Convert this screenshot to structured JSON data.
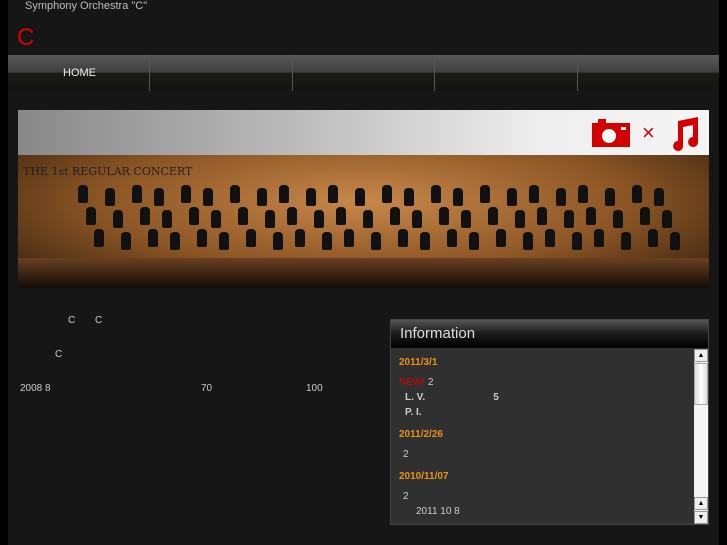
{
  "header": {
    "site_title": "Symphony Orchestra \"C\"",
    "logo": "C"
  },
  "nav": {
    "items": [
      "HOME",
      "",
      "",
      "",
      ""
    ]
  },
  "banner": {
    "caption": "THE 1st REGULAR CONCERT",
    "icons": [
      "camera-icon",
      "times-icon",
      "music-note-icon"
    ],
    "times": "×",
    "accent": "#d40000"
  },
  "intro": {
    "line1a": "C",
    "line1b": "C",
    "line2": "C",
    "line3a": "2008 8",
    "line3b": "70",
    "line3c": "100"
  },
  "info": {
    "title": "Information",
    "entries": [
      {
        "date": "2011/3/1",
        "new": "NEW!",
        "lines": [
          "2",
          "L. V.",
          "5",
          "P. I."
        ]
      },
      {
        "date": "2011/2/26",
        "lines": [
          "2"
        ]
      },
      {
        "date": "2010/11/07",
        "lines": [
          "2",
          "2011 10 8"
        ]
      }
    ]
  }
}
